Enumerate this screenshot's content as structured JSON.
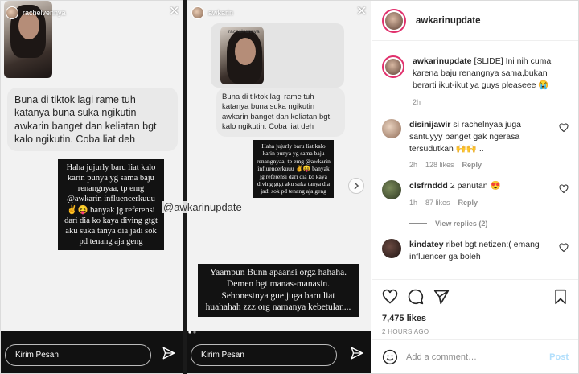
{
  "story1": {
    "username": "rachelvennya",
    "photo_caption": "@rachelvennya_",
    "question": "Buna di tiktok lagi rame tuh katanya buna suka ngikutin awkarin banget dan keliatan bgt kalo ngikutin. Coba liat deh",
    "answer": "Haha jujurly baru liat kalo karin punya yg sama baju renangnyaa, tp emg @awkarin influencerkuuu ✌️😝 banyak jg referensi dari dia ko kaya diving gtgt aku suka tanya dia jadi sok pd tenang aja geng",
    "message_placeholder": "Kirim Pesan"
  },
  "story2": {
    "username": "awkarin",
    "inner_username": "rachelvennya",
    "question": "Buna di tiktok lagi rame tuh katanya buna suka ngikutin awkarin banget dan keliatan bgt kalo ngikutin. Coba liat deh",
    "quoted_answer": "Haha jujurly baru liat kalo karin punya yg sama baju renangnyaa, tp emg @awkarin influencerkuuu ✌️😝 banyak jg referensi dari dia ko kaya diving gtgt aku suka tanya dia jadi sok pd tenang aja geng",
    "reply": "Yaampun Bunn apaansi orgz hahaha. Demen bgt manas-manasin. Sehonestnya gue juga baru liat huahahah zzz org namanya kebetulan...",
    "message_placeholder": "Kirim Pesan"
  },
  "watermark": "@awkarinupdate",
  "post": {
    "header_username": "awkarinupdate",
    "caption_username": "awkarinupdate",
    "caption": "[SLIDE] Ini nih cuma karena baju renangnya sama,bukan berarti ikut-ikut ya guys pleaseee 😭",
    "caption_age": "2h",
    "comments": [
      {
        "username": "disinijawir",
        "text": "si rachelnyaa juga santuyyy banget gak ngerasa tersudutkan 🙌🙌 ..",
        "age": "2h",
        "likes": "128 likes",
        "reply": "Reply",
        "avatar_color": "#c7a48a"
      },
      {
        "username": "clsfrnddd",
        "text": "2 panutan 😍",
        "age": "1h",
        "likes": "87 likes",
        "reply": "Reply",
        "avatar_color": "#4a5a3a"
      }
    ],
    "view_replies": "View replies (2)",
    "comment3": {
      "username": "kindatey",
      "text": "ribet bgt netizen:( emang influencer ga boleh",
      "avatar_color": "#3a2a28"
    },
    "likes": "7,475 likes",
    "time_ago": "2 HOURS AGO",
    "add_comment_placeholder": "Add a comment…",
    "post_label": "Post"
  },
  "colors": {
    "story_ring": "#e1306c",
    "post_button": "#b2dffc",
    "meta_gray": "#8e8e8e"
  }
}
